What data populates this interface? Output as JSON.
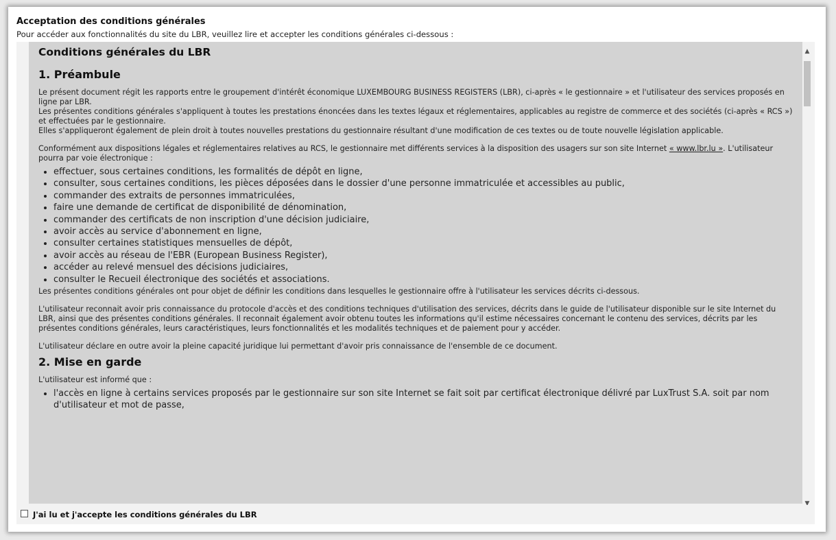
{
  "page": {
    "heading": "Acceptation des conditions générales",
    "intro": "Pour accéder aux fonctionnalités du site du LBR, veuillez lire et accepter les conditions générales ci-dessous :"
  },
  "terms": {
    "title": "Conditions générales du LBR",
    "section1_title": "1. Préambule",
    "s1_p1": "Le présent document régit les rapports entre le groupement d'intérêt économique LUXEMBOURG BUSINESS REGISTERS (LBR), ci-après « le gestionnaire » et l'utilisateur des services proposés en ligne par LBR.",
    "s1_p2": "Les présentes conditions générales s'appliquent à toutes les prestations énoncées dans les textes légaux et réglementaires, applicables au registre de commerce et des sociétés (ci-après « RCS ») et effectuées par le gestionnaire.",
    "s1_p3": "Elles s'appliqueront également de plein droit à toutes nouvelles prestations du gestionnaire résultant d'une modification de ces textes ou de toute nouvelle législation applicable.",
    "s1_p4_before": "Conformément aux dispositions légales et réglementaires relatives au RCS, le gestionnaire met différents services à la disposition des usagers sur son site Internet ",
    "s1_p4_link": "« www.lbr.lu »",
    "s1_p4_after": ". L'utilisateur pourra par voie électronique :",
    "services": [
      "effectuer, sous certaines conditions, les formalités de dépôt en ligne,",
      "consulter, sous certaines conditions, les pièces déposées dans le dossier d'une personne immatriculée et accessibles au public,",
      "commander des extraits de personnes immatriculées,",
      "faire une demande de certificat de disponibilité de dénomination,",
      "commander des certificats de non inscription d'une décision judiciaire,",
      "avoir accès au service d'abonnement en ligne,",
      "consulter certaines statistiques mensuelles de dépôt,",
      "avoir accès au réseau de l'EBR (European Business Register),",
      "accéder au relevé mensuel des décisions judiciaires,",
      "consulter le Recueil électronique des sociétés et associations."
    ],
    "s1_p5": "Les présentes conditions générales ont pour objet de définir les conditions dans lesquelles le gestionnaire offre à l'utilisateur les services décrits ci-dessous.",
    "s1_p6": "L'utilisateur reconnait avoir pris connaissance du protocole d'accès et des conditions techniques d'utilisation des services, décrits dans le guide de l'utilisateur disponible sur le site Internet du LBR, ainsi que des présentes conditions générales. Il reconnait également avoir obtenu toutes les informations qu'il estime nécessaires concernant le contenu des services, décrits par les présentes conditions générales, leurs caractéristiques, leurs fonctionnalités et les modalités techniques et de paiement pour y accéder.",
    "s1_p7": "L'utilisateur déclare en outre avoir la pleine capacité juridique lui permettant d'avoir pris connaissance de l'ensemble de ce document.",
    "section2_title": "2. Mise en garde",
    "s2_p1": "L'utilisateur est informé que :",
    "s2_items": [
      "l'accès en ligne à certains services proposés par le gestionnaire sur son site Internet se fait soit par certificat électronique délivré par LuxTrust S.A. soit par nom d'utilisateur et mot de passe,"
    ]
  },
  "accept": {
    "label": "J'ai lu et j'accepte les conditions générales du LBR",
    "checked": false
  },
  "icons": {
    "scroll_up": "chevron-up-icon",
    "scroll_down": "chevron-down-icon"
  }
}
